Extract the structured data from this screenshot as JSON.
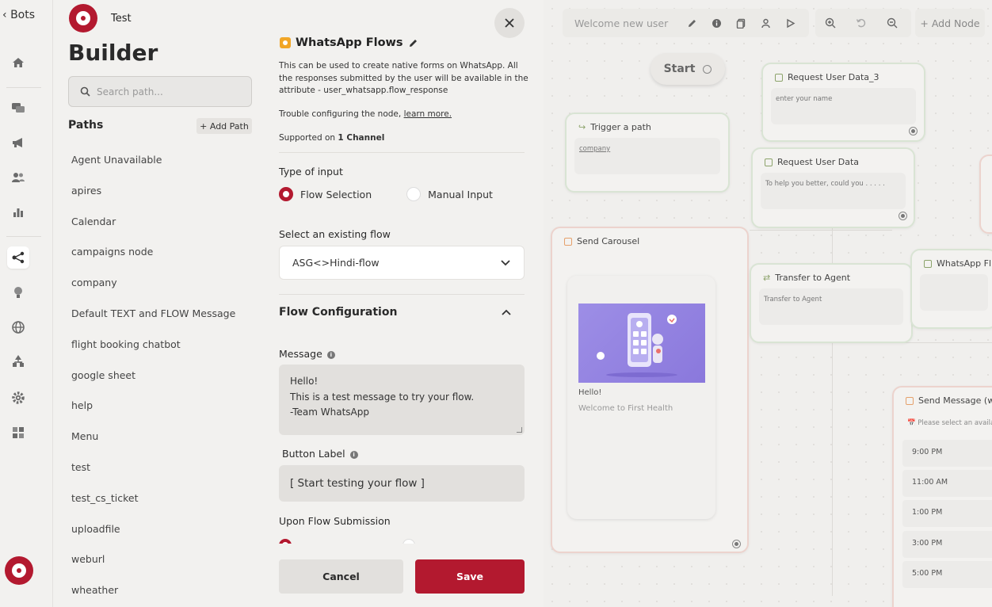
{
  "nav": {
    "back_label": "Bots",
    "rail_icons": [
      "home-icon",
      "chat-icon",
      "megaphone-icon",
      "users-icon",
      "bar-chart-icon",
      "flow-builder-icon",
      "bulb-icon",
      "globe-icon",
      "hierarchy-icon",
      "gear-icon",
      "puzzle-icon"
    ]
  },
  "paths_panel": {
    "bot_name": "Test",
    "heading": "Builder",
    "search_placeholder": "Search path...",
    "paths_title": "Paths",
    "add_path_label": "+ Add Path",
    "items": [
      "Agent Unavailable",
      "apires",
      "Calendar",
      "campaigns node",
      "company",
      "Default TEXT and FLOW Message",
      "flight booking chatbot",
      "google sheet",
      "help",
      "Menu",
      "test",
      "test_cs_ticket",
      "uploadfile",
      "weburl",
      "wheather"
    ]
  },
  "config": {
    "title": "WhatsApp Flows",
    "description": "This can be used to create native forms on WhatsApp. All the responses submitted by the user will be available in the attribute - user_whatsapp.flow_response",
    "trouble_prefix": "Trouble configuring the node,",
    "learn_more": "learn more.",
    "supported_prefix": "Supported on",
    "supported_channels": "1 Channel",
    "type_of_input_label": "Type of input",
    "input_options": [
      "Flow Selection",
      "Manual Input"
    ],
    "selected_input": "Flow Selection",
    "select_flow_label": "Select an existing flow",
    "selected_flow": "ASG<>Hindi-flow",
    "flow_configuration_title": "Flow Configuration",
    "message_label": "Message",
    "message_lines": [
      "Hello!",
      "This is a test message to try your flow.",
      "-Team WhatsApp"
    ],
    "button_label_label": "Button Label",
    "button_label_value": "[ Start testing your flow ]",
    "upon_submission_label": "Upon Flow Submission",
    "cancel_label": "Cancel",
    "save_label": "Save"
  },
  "canvas": {
    "toolbar": {
      "flow_name": "Welcome new user",
      "add_node_label": "+ Add Node"
    },
    "start_label": "Start",
    "nodes": {
      "request_user_data_3": {
        "title": "Request User Data_3",
        "body": "enter your name"
      },
      "trigger_path": {
        "title": "Trigger a path",
        "body": "company"
      },
      "request_user_data": {
        "title": "Request User Data",
        "body": "To help you better, could you . . . . ."
      },
      "send_carousel": {
        "title": "Send Carousel",
        "card_title": "Hello!",
        "card_subtitle": "Welcome to First Health"
      },
      "transfer_agent": {
        "title": "Transfer to Agent",
        "body": "Transfer to Agent"
      },
      "whatsapp_flows": {
        "title": "WhatsApp Fl"
      },
      "send_message": {
        "title": "Send Message (w",
        "body": "📅 Please select an availa",
        "slots": [
          "9:00 PM",
          "11:00 AM",
          "1:00 PM",
          "3:00 PM",
          "5:00 PM"
        ]
      }
    }
  },
  "colors": {
    "brand": "#b3192f",
    "panel_bg": "#f2f1ef",
    "canvas_bg": "#f0efed"
  }
}
